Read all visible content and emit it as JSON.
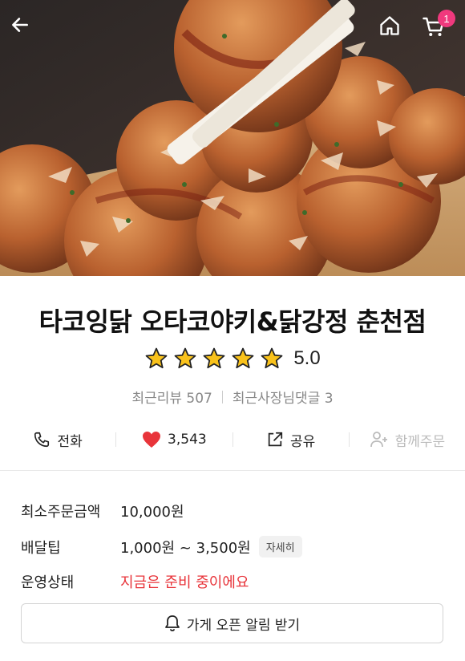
{
  "header": {
    "cart_count": "1"
  },
  "store": {
    "name": "타코잉닭 오타코야키&닭강정 춘천점",
    "rating": 5.0,
    "rating_label": "5.0",
    "recent_reviews": "최근리뷰 507",
    "owner_replies": "최근사장님댓글 3"
  },
  "actions": {
    "call": "전화",
    "likes": "3,543",
    "share": "공유",
    "group_order": "함께주문"
  },
  "info": {
    "min_order_label": "최소주문금액",
    "min_order_value": "10,000원",
    "delivery_tip_label": "배달팁",
    "delivery_tip_value": "1,000원 ~ 3,500원",
    "detail_chip": "자세히",
    "status_label": "운영상태",
    "status_value": "지금은 준비 중이에요"
  },
  "notify_button": "가게 오픈 알림 받기",
  "colors": {
    "accent_pink": "#f0397d",
    "status_red": "#e8343a",
    "heart_red": "#e8343a",
    "star_yellow": "#f9c21b"
  },
  "icons": [
    "back-arrow-icon",
    "home-icon",
    "cart-icon",
    "star-icon",
    "phone-icon",
    "heart-icon",
    "share-icon",
    "add-person-icon",
    "bell-icon"
  ]
}
